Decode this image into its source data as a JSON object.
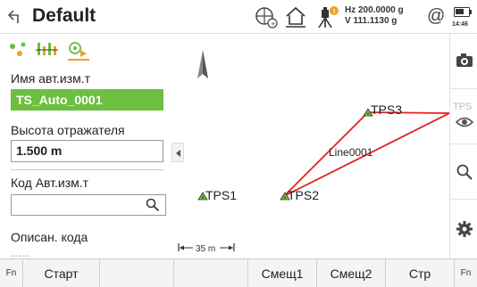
{
  "header": {
    "title": "Default",
    "status_hz": "Hz 200.0000 g",
    "status_v": "V   111.1130 g",
    "at_symbol": "@",
    "clock": "14:46",
    "icons": [
      "back-icon",
      "target-icon",
      "home-icon",
      "instrument-warning-icon",
      "at-icon",
      "battery-icon"
    ]
  },
  "left": {
    "point_name_label": "Имя авт.изм.т",
    "point_name_value": "TS_Auto_0001",
    "reflector_height_label": "Высота отражателя",
    "reflector_height_value": "1.500 m",
    "code_label": "Код Авт.изм.т",
    "code_value": "",
    "code_desc_label": "Описан. кода",
    "code_desc_value": "-----"
  },
  "map": {
    "points": [
      "TPS1",
      "TPS2",
      "TPS3"
    ],
    "line_label": "Line0001",
    "edge_label": "TPS",
    "scale_label": "35 m"
  },
  "bottom": {
    "fn_left": "Fn",
    "fn_right": "Fn",
    "buttons": [
      "Старт",
      "",
      "",
      "Смещ1",
      "Смещ2",
      "Стр"
    ]
  },
  "colors": {
    "accent_green": "#6cbf3f",
    "line_red": "#e02020"
  }
}
